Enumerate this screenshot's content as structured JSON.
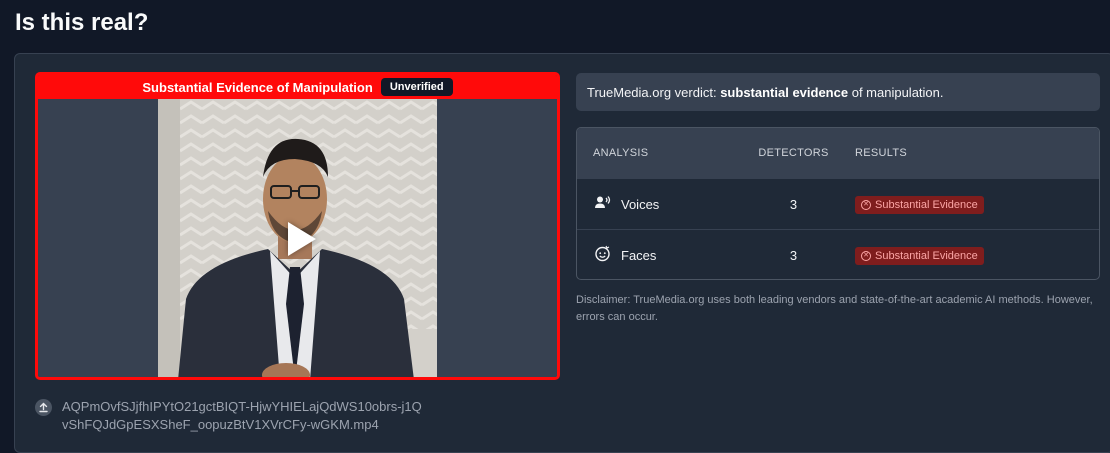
{
  "page": {
    "title": "Is this real?"
  },
  "media": {
    "header_title": "Substantial Evidence of Manipulation",
    "badge": "Unverified",
    "play_icon": "play-icon",
    "filename": "AQPmOvfSJjfhIPYtO21gctBIQT-HjwYHIELajQdWS10obrs-j1QvShFQJdGpESXSheF_oopuzBtV1XVrCFy-wGKM.mp4",
    "upload_icon": "upload-icon"
  },
  "verdict": {
    "prefix": "TrueMedia.org verdict: ",
    "strong": "substantial evidence",
    "suffix": " of manipulation."
  },
  "table": {
    "headers": {
      "analysis": "ANALYSIS",
      "detectors": "DETECTORS",
      "results": "RESULTS"
    },
    "rows": [
      {
        "icon": "voice-icon",
        "label": "Voices",
        "detectors": "3",
        "result": "Substantial Evidence"
      },
      {
        "icon": "face-icon",
        "label": "Faces",
        "detectors": "3",
        "result": "Substantial Evidence"
      }
    ]
  },
  "disclaimer": "Disclaimer: TrueMedia.org uses both leading vendors and state-of-the-art academic AI methods. However, errors can occur.",
  "colors": {
    "alert_red": "#ff0a0a",
    "badge_bg": "#7f1d1d",
    "badge_text": "#fca5a5",
    "page_bg": "#111827",
    "panel_bg": "#1f2937"
  }
}
